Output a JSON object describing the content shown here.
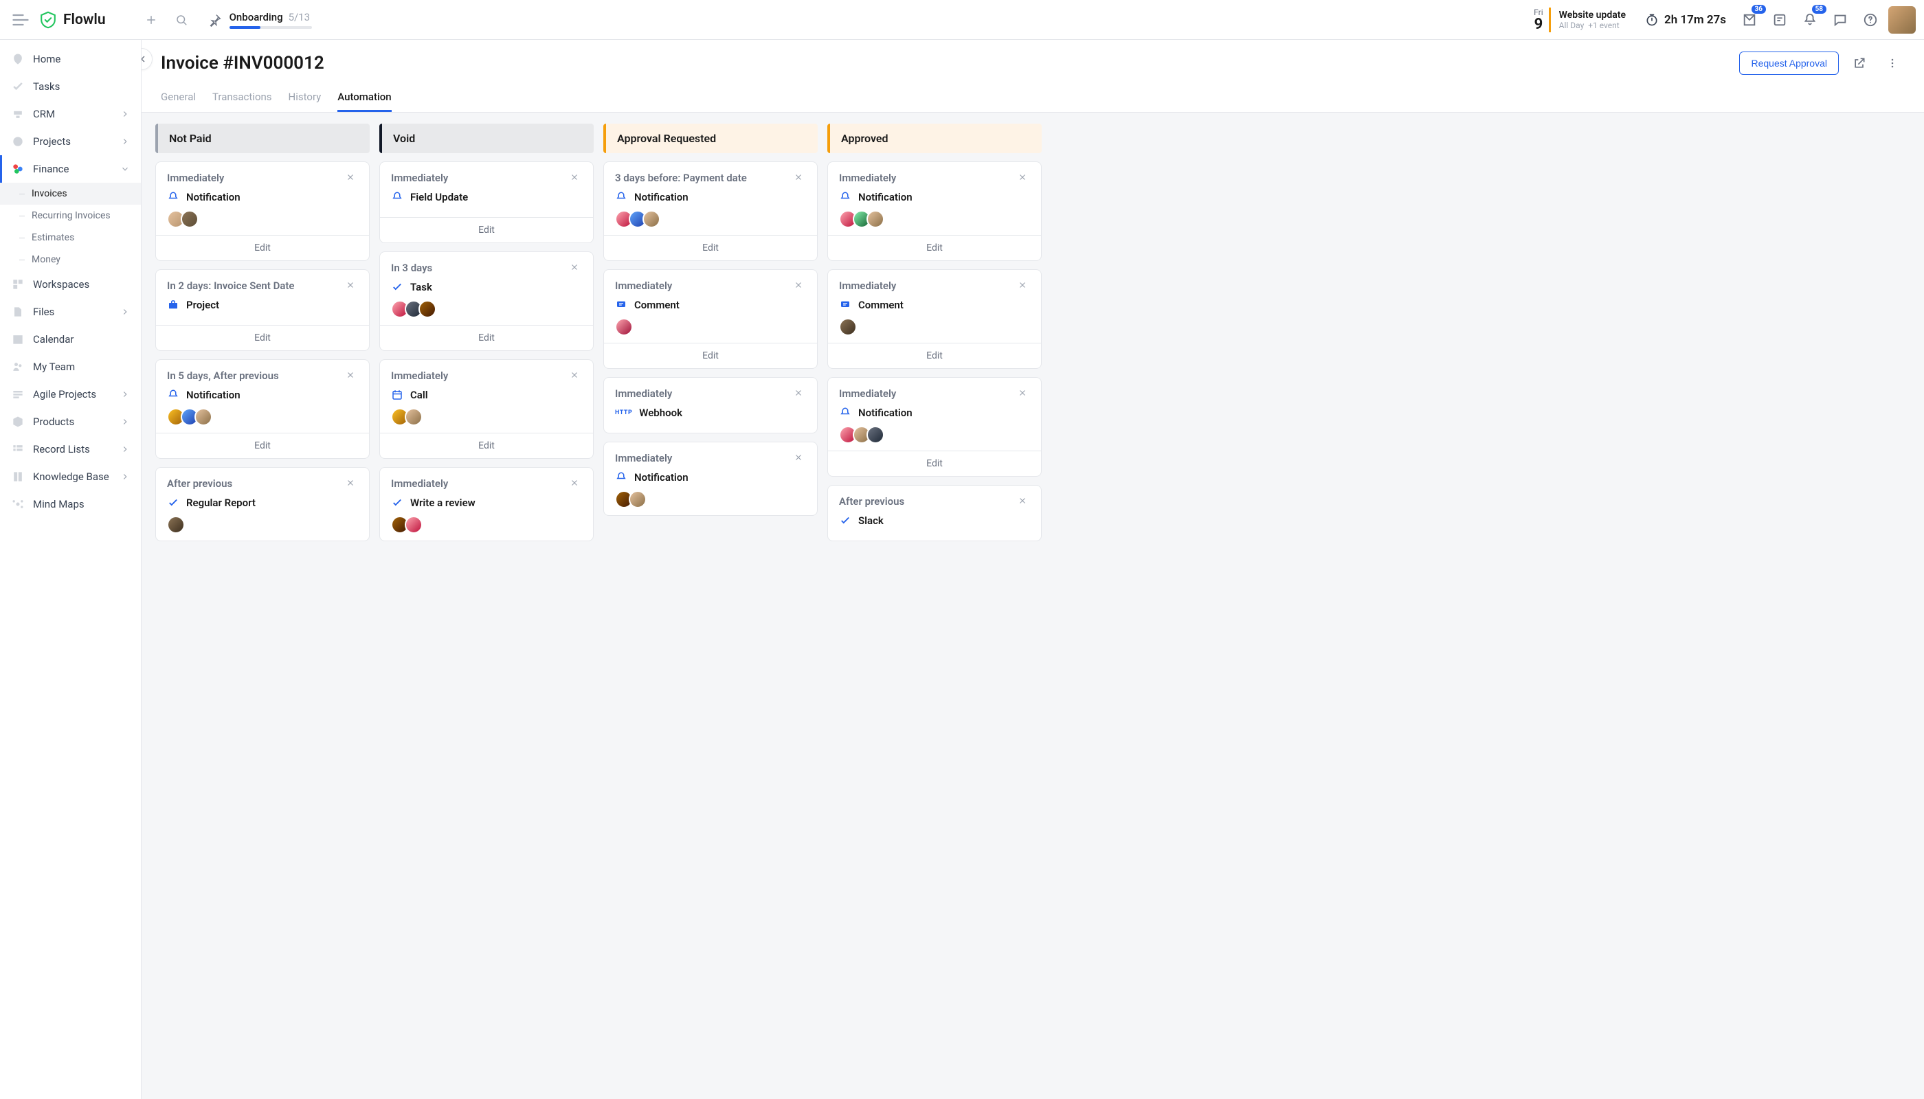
{
  "brand": "Flowlu",
  "onboarding": {
    "label": "Onboarding",
    "progress": "5/13"
  },
  "date": {
    "weekday": "Fri",
    "day": "9"
  },
  "event": {
    "title": "Website update",
    "allday": "All Day",
    "more": "+1 event"
  },
  "timer": "2h 17m 27s",
  "badges": {
    "inbox": "36",
    "bell": "58"
  },
  "nav": {
    "home": "Home",
    "tasks": "Tasks",
    "crm": "CRM",
    "projects": "Projects",
    "finance": "Finance",
    "invoices": "Invoices",
    "recurring": "Recurring Invoices",
    "estimates": "Estimates",
    "money": "Money",
    "workspaces": "Workspaces",
    "files": "Files",
    "calendar": "Calendar",
    "team": "My Team",
    "agile": "Agile Projects",
    "products": "Products",
    "records": "Record Lists",
    "kb": "Knowledge Base",
    "mind": "Mind Maps"
  },
  "page": {
    "title": "Invoice #INV000012",
    "request_approval": "Request Approval",
    "tabs": {
      "general": "General",
      "transactions": "Transactions",
      "history": "History",
      "automation": "Automation"
    }
  },
  "edit": "Edit",
  "cols": {
    "notpaid": "Not Paid",
    "void": "Void",
    "approval": "Approval Requested",
    "approved": "Approved"
  },
  "actions": {
    "notification": "Notification",
    "field_update": "Field Update",
    "project": "Project",
    "task": "Task",
    "call": "Call",
    "comment": "Comment",
    "webhook": "Webhook",
    "regular_report": "Regular Report",
    "write_review": "Write a review",
    "slack": "Slack"
  },
  "triggers": {
    "immediately": "Immediately",
    "in2days_sent": "In 2 days: Invoice Sent Date",
    "in5days_after": "In 5 days, After previous",
    "after_previous": "After previous",
    "in3days": "In 3 days",
    "3days_before_payment": "3 days before: Payment date"
  }
}
